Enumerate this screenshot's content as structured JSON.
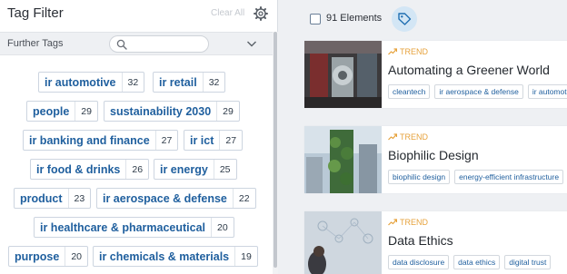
{
  "filter_panel": {
    "title": "Tag Filter",
    "clear_label": "Clear All",
    "further_tags_label": "Further Tags",
    "search_placeholder": "",
    "tags": [
      {
        "label": "ir automotive",
        "count": "32"
      },
      {
        "label": "ir retail",
        "count": "32"
      },
      {
        "label": "people",
        "count": "29"
      },
      {
        "label": "sustainability 2030",
        "count": "29"
      },
      {
        "label": "ir banking and finance",
        "count": "27"
      },
      {
        "label": "ir ict",
        "count": "27"
      },
      {
        "label": "ir food & drinks",
        "count": "26"
      },
      {
        "label": "ir energy",
        "count": "25"
      },
      {
        "label": "product",
        "count": "23"
      },
      {
        "label": "ir aerospace & defense",
        "count": "22"
      },
      {
        "label": "ir healthcare & pharmaceutical",
        "count": "20"
      },
      {
        "label": "purpose",
        "count": "20"
      },
      {
        "label": "ir chemicals & materials",
        "count": "19"
      }
    ]
  },
  "results": {
    "count_label": "91 Elements",
    "cards": [
      {
        "type": "TREND",
        "title": "Automating a Greener World",
        "tags": [
          "cleantech",
          "ir aerospace & defense",
          "ir automotive"
        ]
      },
      {
        "type": "TREND",
        "title": "Biophilic Design",
        "tags": [
          "biophilic design",
          "energy-efficient infrastructure"
        ]
      },
      {
        "type": "TREND",
        "title": "Data Ethics",
        "tags": [
          "data disclosure",
          "data ethics",
          "digital trust"
        ]
      }
    ]
  },
  "colors": {
    "tag_text": "#1f5f9e",
    "trend_accent": "#e6a23c",
    "panel_bg": "#ffffff",
    "page_bg": "#eef0f3"
  }
}
